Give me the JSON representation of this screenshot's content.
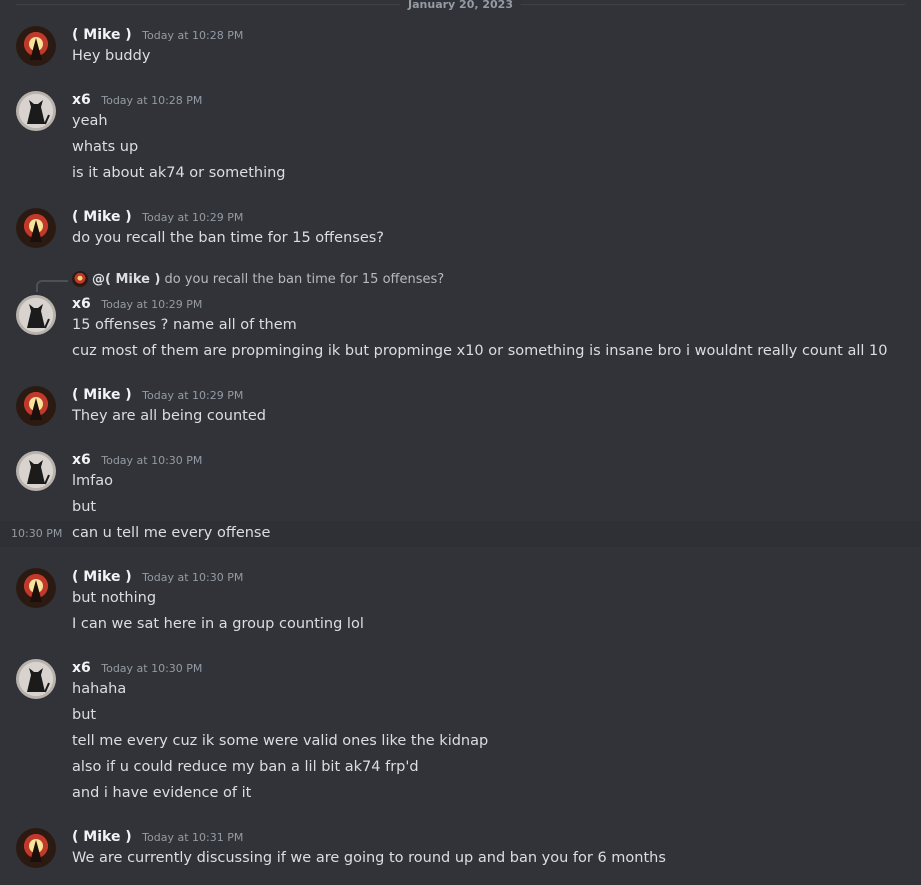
{
  "date_divider": "January 20, 2023",
  "users": {
    "mike": {
      "name": "( Mike )"
    },
    "x6": {
      "name": "x6"
    }
  },
  "groups": [
    {
      "author": "( Mike )",
      "time": "Today at 10:28 PM",
      "lines": [
        "Hey buddy"
      ]
    },
    {
      "author": "x6",
      "time": "Today at 10:28 PM",
      "lines": [
        "yeah",
        "whats up",
        "is it about ak74 or something"
      ]
    },
    {
      "author": "( Mike )",
      "time": "Today at 10:29 PM",
      "lines": [
        "do you recall the ban time for 15 offenses?"
      ]
    },
    {
      "author": "x6",
      "time": "Today at 10:29 PM",
      "reply": {
        "mention": "@( Mike )",
        "text": "do you recall the ban time for 15 offenses?"
      },
      "lines": [
        "15 offenses ? name all of them",
        "cuz most of them are propminging ik but propminge x10 or something is insane bro i wouldnt really count all 10"
      ]
    },
    {
      "author": "( Mike )",
      "time": "Today at 10:29 PM",
      "lines": [
        "They are all being counted"
      ]
    },
    {
      "author": "x6",
      "time": "Today at 10:30 PM",
      "lines": [
        "lmfao",
        "but",
        "can u tell me every offense"
      ],
      "hover_time": "10:30 PM"
    },
    {
      "author": "( Mike )",
      "time": "Today at 10:30 PM",
      "lines": [
        "but nothing",
        "I can we sat here in a group counting lol"
      ]
    },
    {
      "author": "x6",
      "time": "Today at 10:30 PM",
      "lines": [
        "hahaha",
        "but",
        "tell me every cuz ik some were valid ones like the kidnap",
        "also if u could reduce my ban a lil bit ak74 frp'd",
        "and i have evidence of it"
      ]
    },
    {
      "author": "( Mike )",
      "time": "Today at 10:31 PM",
      "lines": [
        "We are currently discussing if we are going to round up and ban you for 6 months"
      ]
    }
  ]
}
